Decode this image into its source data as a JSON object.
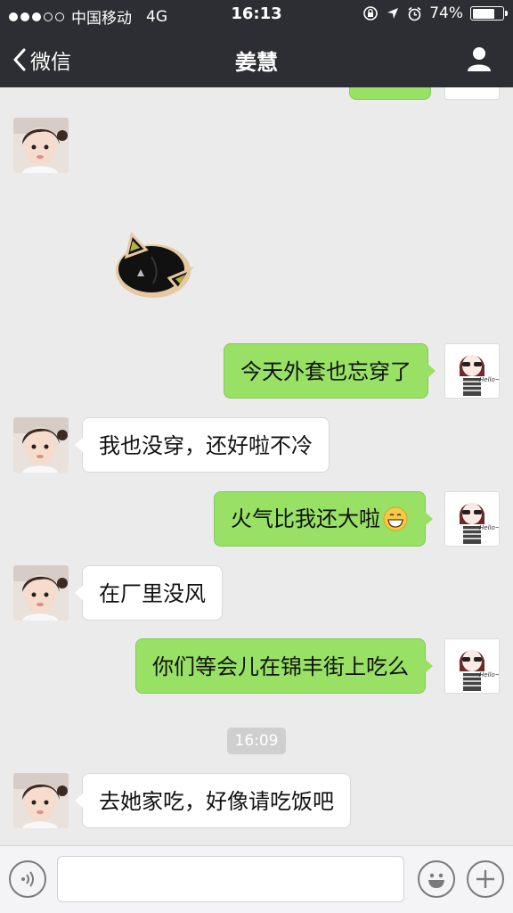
{
  "status": {
    "carrier": "中国移动",
    "network": "4G",
    "time": "16:13",
    "battery": "74%",
    "battery_level": 0.74
  },
  "nav": {
    "back_label": "微信",
    "title": "姜慧"
  },
  "messages": [
    {
      "sender": "self",
      "text": "今天外套也忘穿了"
    },
    {
      "sender": "contact",
      "text": "我也没穿，还好啦不冷"
    },
    {
      "sender": "self",
      "text": "火气比我还大啦"
    },
    {
      "sender": "contact",
      "text": "在厂里没风"
    },
    {
      "sender": "self",
      "text": "你们等会儿在锦丰街上吃么"
    },
    {
      "sender": "contact",
      "text": "去她家吃，好像请吃饭吧"
    }
  ],
  "timestamp": "16:09",
  "sticker": "black-cat-sticker",
  "avatars": {
    "self_avatar_text": "Hello~"
  },
  "input": {
    "placeholder": ""
  },
  "icons": {
    "voice": "voice-icon",
    "emoji": "emoji-icon",
    "plus": "plus-icon",
    "profile": "person-icon",
    "back": "chevron-left-icon"
  },
  "colors": {
    "nav_bg": "#2d2e33",
    "chat_bg": "#ebebeb",
    "out_bubble": "#98e165",
    "in_bubble": "#ffffff"
  }
}
